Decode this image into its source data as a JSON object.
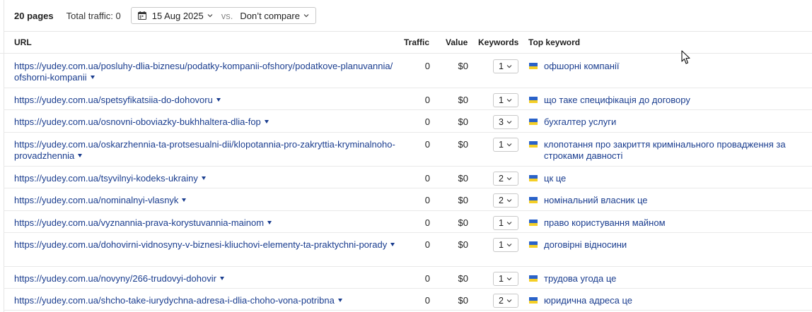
{
  "summary": {
    "pages": "20 pages",
    "total_traffic": "Total traffic: 0",
    "date": "15 Aug 2025",
    "vs": "vs.",
    "compare": "Don’t compare"
  },
  "columns": {
    "url": "URL",
    "traffic": "Traffic",
    "value": "Value",
    "keywords": "Keywords",
    "top_keyword": "Top keyword"
  },
  "rows": [
    {
      "url": "https://yudey.com.ua/posluhy-dlia-biznesu/podatky-kompanii-ofshory/podatkove-planuvannia/ofshorni-kompanii",
      "traffic": "0",
      "value": "$0",
      "keywords": "1",
      "top_keyword": "офшорні компанії"
    },
    {
      "url": "https://yudey.com.ua/spetsyfikatsiia-do-dohovoru",
      "traffic": "0",
      "value": "$0",
      "keywords": "1",
      "top_keyword": "що таке специфікація до договору"
    },
    {
      "url": "https://yudey.com.ua/osnovni-oboviazky-bukhhaltera-dlia-fop",
      "traffic": "0",
      "value": "$0",
      "keywords": "3",
      "top_keyword": "бухгалтер услуги"
    },
    {
      "url": "https://yudey.com.ua/oskarzhennia-ta-protsesualni-dii/klopotannia-pro-zakryttia-kryminalnoho-provadzhennia",
      "traffic": "0",
      "value": "$0",
      "keywords": "1",
      "top_keyword": "клопотання про закриття кримінального провадження за строками давності"
    },
    {
      "url": "https://yudey.com.ua/tsyvilnyi-kodeks-ukrainy",
      "traffic": "0",
      "value": "$0",
      "keywords": "2",
      "top_keyword": "цк це"
    },
    {
      "url": "https://yudey.com.ua/nominalnyi-vlasnyk",
      "traffic": "0",
      "value": "$0",
      "keywords": "2",
      "top_keyword": "номінальний власник це"
    },
    {
      "url": "https://yudey.com.ua/vyznannia-prava-korystuvannia-mainom",
      "traffic": "0",
      "value": "$0",
      "keywords": "1",
      "top_keyword": "право користування майном"
    },
    {
      "url": "https://yudey.com.ua/dohovirni-vidnosyny-v-biznesi-kliuchovi-elementy-ta-praktychni-porady",
      "traffic": "0",
      "value": "$0",
      "keywords": "1",
      "top_keyword": "договірні відносини"
    },
    {
      "url": "https://yudey.com.ua/novyny/266-trudovyi-dohovir",
      "traffic": "0",
      "value": "$0",
      "keywords": "1",
      "top_keyword": "трудова угода це"
    },
    {
      "url": "https://yudey.com.ua/shcho-take-iurydychna-adresa-i-dlia-choho-vona-potribna",
      "traffic": "0",
      "value": "$0",
      "keywords": "2",
      "top_keyword": "юридична адреса це"
    }
  ]
}
